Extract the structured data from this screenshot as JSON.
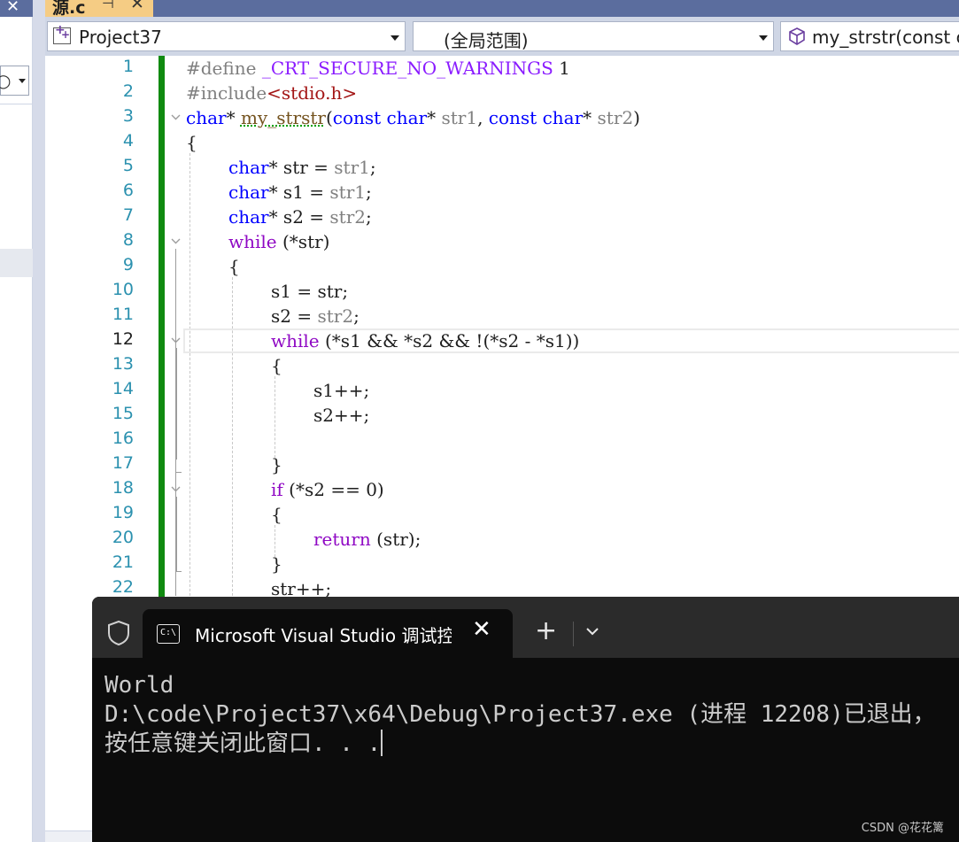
{
  "document_tab": {
    "name": "源.c",
    "pin_icon": "pin-icon",
    "close_icon": "close-icon"
  },
  "navbar": {
    "project": "Project37",
    "scope": "(全局范围)",
    "member": "my_strstr(const c"
  },
  "editor": {
    "current_line": 12,
    "line_numbers": [
      "1",
      "2",
      "3",
      "4",
      "5",
      "6",
      "7",
      "8",
      "9",
      "10",
      "11",
      "12",
      "13",
      "14",
      "15",
      "16",
      "17",
      "18",
      "19",
      "20",
      "21",
      "22"
    ],
    "lines": [
      {
        "pp": "#define ",
        "mac": "_CRT_SECURE_NO_WARNINGS",
        "rest": " 1"
      },
      {
        "pp": "#include",
        "str": "<stdio.h>"
      },
      {
        "ret": "char",
        "star": "* ",
        "fn": "my_strstr",
        "p1": "(",
        "kw1": "const",
        "sp1": " ",
        "t1": "char",
        "s1": "* ",
        "a1": "str1",
        "c1": ", ",
        "kw2": "const",
        "sp2": " ",
        "t2": "char",
        "s2": "* ",
        "a2": "str2",
        "p2": ")"
      },
      {
        "text": "{"
      },
      {
        "t": "char",
        "rest1": "* str = ",
        "v": "str1",
        "end": ";"
      },
      {
        "t": "char",
        "rest1": "* s1 = ",
        "v": "str1",
        "end": ";"
      },
      {
        "t": "char",
        "rest1": "* s2 = ",
        "v": "str2",
        "end": ";"
      },
      {
        "kw": "while",
        "rest": " (*str)"
      },
      {
        "text": "{"
      },
      {
        "text": "s1 = str;"
      },
      {
        "pre": "s2 = ",
        "v": "str2",
        "end": ";"
      },
      {
        "kw": "while",
        "rest": " (*s1 && *s2 && !(*s2 - *s1))"
      },
      {
        "text": "{"
      },
      {
        "text": "s1++;"
      },
      {
        "text": "s2++;"
      },
      {
        "text": ""
      },
      {
        "text": "}"
      },
      {
        "kw": "if",
        "rest": " (*s2 == 0)"
      },
      {
        "text": "{"
      },
      {
        "kw": "return",
        "rest": " (str);"
      },
      {
        "text": "}"
      },
      {
        "text": "str++;"
      }
    ]
  },
  "console": {
    "tab_title": "Microsoft Visual Studio 调试控制台",
    "tab_icon": "cmd-icon",
    "new_tab": "+",
    "output": [
      "World",
      "D:\\code\\Project37\\x64\\Debug\\Project37.exe (进程 12208)已退出，",
      "按任意键关闭此窗口. . ."
    ]
  },
  "watermark": "CSDN @花花篱",
  "colors": {
    "keyword": "#0000ff",
    "control": "#8f08c4",
    "macro": "#8a1bff",
    "string": "#a31515",
    "line_number": "#2b91af",
    "change_bar": "#108a10",
    "console_bg": "#0c0c0c"
  }
}
